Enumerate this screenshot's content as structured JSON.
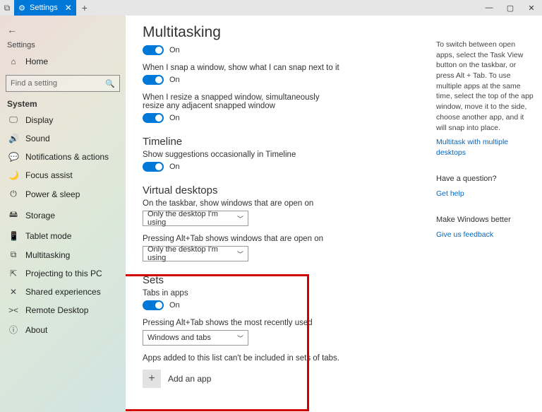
{
  "titlebar": {
    "tab_label": "Settings"
  },
  "sidebar": {
    "back": "←",
    "app_title": "Settings",
    "home": "Home",
    "search_placeholder": "Find a setting",
    "section": "System",
    "items": [
      {
        "icon": "🖵",
        "label": "Display"
      },
      {
        "icon": "🔊",
        "label": "Sound"
      },
      {
        "icon": "💬",
        "label": "Notifications & actions"
      },
      {
        "icon": "🌙",
        "label": "Focus assist"
      },
      {
        "icon": "⏻",
        "label": "Power & sleep"
      },
      {
        "icon": "🖴",
        "label": "Storage"
      },
      {
        "icon": "📱",
        "label": "Tablet mode"
      },
      {
        "icon": "⧉",
        "label": "Multitasking"
      },
      {
        "icon": "⇱",
        "label": "Projecting to this PC"
      },
      {
        "icon": "✕",
        "label": "Shared experiences"
      },
      {
        "icon": "><",
        "label": "Remote Desktop"
      },
      {
        "icon": "ⓘ",
        "label": "About"
      }
    ]
  },
  "main": {
    "title": "Multitasking",
    "snap_on": "On",
    "snap_show": "When I snap a window, show what I can snap next to it",
    "snap_on2": "On",
    "snap_resize": "When I resize a snapped window, simultaneously resize any adjacent snapped window",
    "snap_on3": "On",
    "timeline_head": "Timeline",
    "timeline_text": "Show suggestions occasionally in Timeline",
    "timeline_on": "On",
    "vd_head": "Virtual desktops",
    "vd_text1": "On the taskbar, show windows that are open on",
    "vd_sel1": "Only the desktop I'm using",
    "vd_text2": "Pressing Alt+Tab shows windows that are open on",
    "vd_sel2": "Only the desktop I'm using",
    "sets_head": "Sets",
    "sets_tabs": "Tabs in apps",
    "sets_on": "On",
    "sets_alttab": "Pressing Alt+Tab shows the most recently used",
    "sets_sel": "Windows and tabs",
    "sets_note": "Apps added to this list can't be included in sets of tabs.",
    "add_app": "Add an app"
  },
  "right": {
    "tip": "To switch between open apps, select the Task View button on the taskbar, or press Alt + Tab. To use multiple apps at the same time, select the top of the app window, move it to the side, choose another app, and it will snap into place.",
    "link1": "Multitask with multiple desktops",
    "q_head": "Have a question?",
    "q_link": "Get help",
    "f_head": "Make Windows better",
    "f_link": "Give us feedback"
  }
}
